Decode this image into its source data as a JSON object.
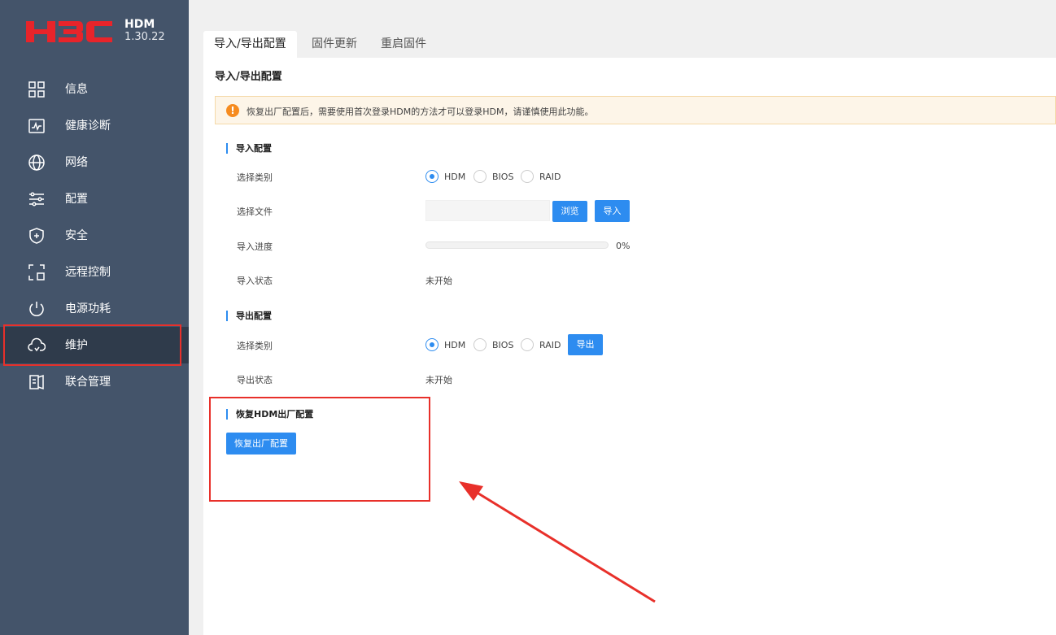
{
  "brand": {
    "product": "HDM",
    "version": "1.30.22",
    "logo_text": "H3C"
  },
  "nav": {
    "items": [
      {
        "label": "信息",
        "icon": "grid-icon"
      },
      {
        "label": "健康诊断",
        "icon": "health-monitor-icon"
      },
      {
        "label": "网络",
        "icon": "globe-icon"
      },
      {
        "label": "配置",
        "icon": "sliders-icon"
      },
      {
        "label": "安全",
        "icon": "shield-icon"
      },
      {
        "label": "远程控制",
        "icon": "remote-control-icon"
      },
      {
        "label": "电源功耗",
        "icon": "power-icon"
      },
      {
        "label": "维护",
        "icon": "cloud-maintenance-icon",
        "active": true
      },
      {
        "label": "联合管理",
        "icon": "federation-icon"
      }
    ]
  },
  "tabs": [
    {
      "label": "导入/导出配置",
      "active": true
    },
    {
      "label": "固件更新"
    },
    {
      "label": "重启固件"
    }
  ],
  "page_title": "导入/导出配置",
  "alert": {
    "text": "恢复出厂配置后，需要使用首次登录HDM的方法才可以登录HDM，请谨慎使用此功能。"
  },
  "import_section": {
    "title": "导入配置",
    "type_label": "选择类别",
    "options": [
      "HDM",
      "BIOS",
      "RAID"
    ],
    "selected": "HDM",
    "file_label": "选择文件",
    "file_value": "",
    "browse_label": "浏览",
    "import_label": "导入",
    "progress_label": "导入进度",
    "progress": 0,
    "progress_text": "0%",
    "status_label": "导入状态",
    "status_value": "未开始"
  },
  "export_section": {
    "title": "导出配置",
    "type_label": "选择类别",
    "options": [
      "HDM",
      "BIOS",
      "RAID"
    ],
    "selected": "HDM",
    "export_label": "导出",
    "status_label": "导出状态",
    "status_value": "未开始"
  },
  "restore_section": {
    "title": "恢复HDM出厂配置",
    "button_label": "恢复出厂配置"
  },
  "colors": {
    "sidebar_bg": "#44546a",
    "sidebar_active": "#2f3b4b",
    "accent": "#2d8cf0",
    "brand_red": "#e8242a",
    "annotation_red": "#e8302a",
    "alert_bg": "#fdf5e8"
  }
}
